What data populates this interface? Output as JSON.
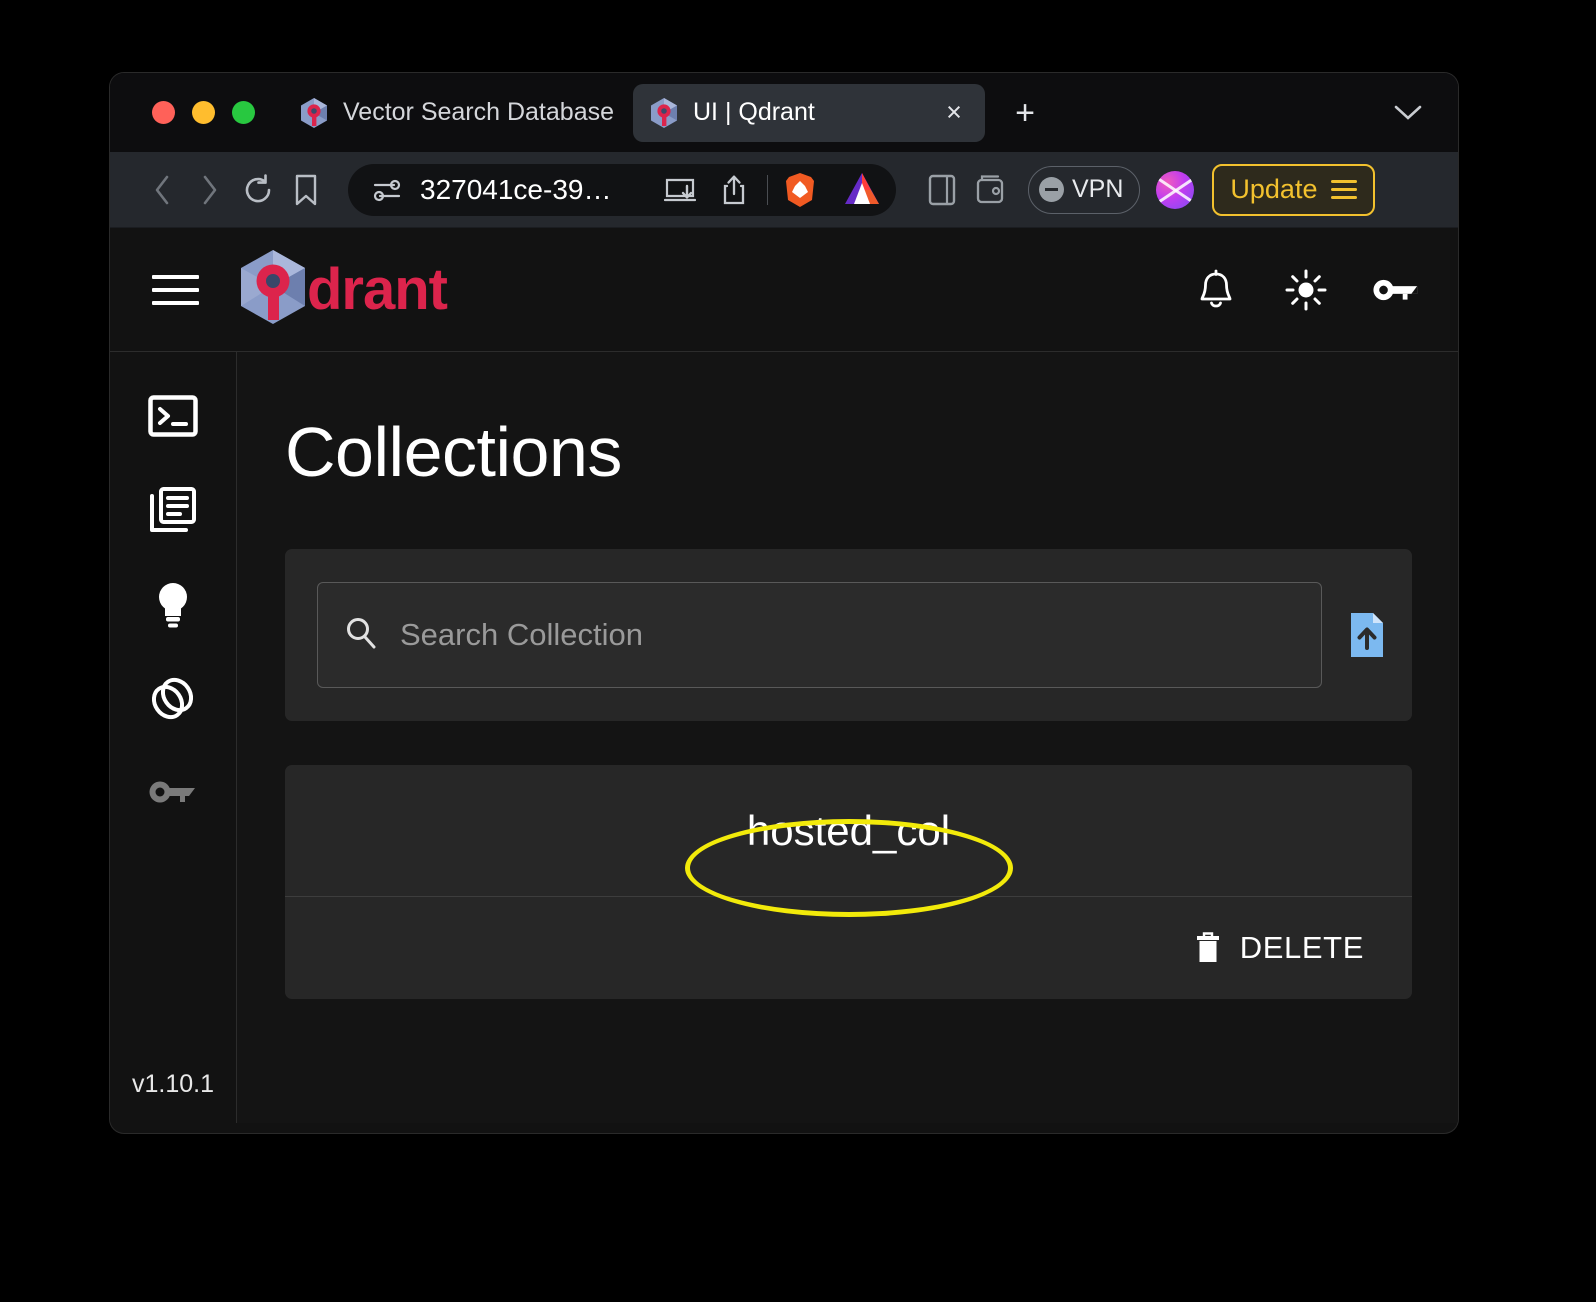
{
  "browser": {
    "window_controls": [
      "close",
      "minimize",
      "maximize"
    ],
    "tabs": [
      {
        "title": "Vector Search Database | Qdrant C",
        "favicon": "qdrant-favicon",
        "active": false
      },
      {
        "title": "UI | Qdrant",
        "favicon": "qdrant-favicon",
        "active": true
      }
    ],
    "new_tab_label": "+",
    "close_tab_label": "×",
    "toolbar": {
      "back_icon": "chevron-left-icon",
      "forward_icon": "chevron-right-icon",
      "reload_icon": "reload-icon",
      "bookmark_icon": "bookmark-icon",
      "url_text": "327041ce-39…",
      "site_settings_icon": "tune-icon",
      "download_icon": "download-icon",
      "share_icon": "share-icon",
      "brave_shield_icon": "brave-lion-icon",
      "bat_icon": "bat-triangle-icon",
      "sidebar_icon": "sidebar-panel-icon",
      "wallet_icon": "wallet-icon",
      "vpn_label": "VPN",
      "profile_icon": "profile-avatar-icon",
      "update_label": "Update",
      "menu_icon": "hamburger-menu-icon"
    }
  },
  "app": {
    "header": {
      "menu_icon": "hamburger-menu-icon",
      "logo_text": "drant",
      "logo_mark": "qdrant-logo-icon",
      "actions": [
        {
          "name": "notifications-icon",
          "icon": "bell-icon"
        },
        {
          "name": "theme-toggle-icon",
          "icon": "sun-icon"
        },
        {
          "name": "api-key-icon",
          "icon": "key-icon"
        }
      ]
    },
    "sidebar": {
      "items": [
        {
          "name": "sidebar-item-console",
          "icon": "terminal-icon",
          "active": true
        },
        {
          "name": "sidebar-item-collections",
          "icon": "collections-icon",
          "active": true
        },
        {
          "name": "sidebar-item-tutorial",
          "icon": "lightbulb-icon",
          "active": true
        },
        {
          "name": "sidebar-item-datasets",
          "icon": "rings-icon",
          "active": true
        },
        {
          "name": "sidebar-item-access",
          "icon": "key-icon",
          "active": false
        }
      ],
      "version": "v1.10.1"
    },
    "main": {
      "title": "Collections",
      "search": {
        "placeholder": "Search Collection",
        "value": "",
        "search_icon": "search-icon",
        "upload_icon": "file-upload-icon"
      },
      "collections": [
        {
          "name": "hosted_col",
          "delete_label": "DELETE",
          "delete_icon": "trash-icon",
          "highlighted": true
        }
      ]
    }
  },
  "annotation": {
    "shape": "ellipse",
    "color": "#f2ea0a",
    "target": "hosted_col"
  },
  "colors": {
    "page_background": "#000000",
    "window_background": "#121212",
    "tabstrip_background": "#0d0d0f",
    "toolbar_background": "#25282d",
    "main_background": "#141414",
    "card_background": "#272727",
    "brand_red": "#dc244c",
    "accent_blue": "#7cb9f0",
    "update_amber": "#f2c12e",
    "annotation_yellow": "#f2ea0a"
  }
}
